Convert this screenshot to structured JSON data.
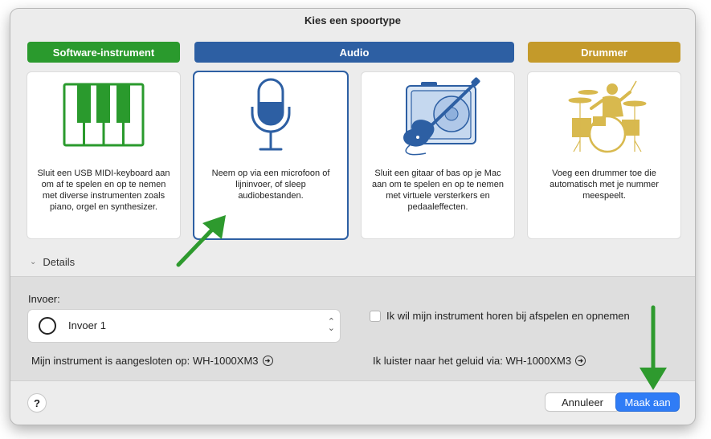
{
  "dialog": {
    "title": "Kies een spoortype"
  },
  "categories": [
    {
      "label": "Software-instrument",
      "color": "#2a9a2d",
      "description": "Sluit een USB MIDI-keyboard aan om af te spelen en op te nemen met diverse instrumenten zoals piano, orgel en synthesizer.",
      "icon": "piano-keyboard-icon"
    },
    {
      "label": "Audio",
      "color": "#2d5fa3",
      "description": "Neem op via een microfoon of lijninvoer, of sleep audiobestanden.",
      "icon": "microphone-icon"
    },
    {
      "label": "",
      "description": "Sluit een gitaar of bas op je Mac aan om te spelen en op te nemen met virtuele versterkers en pedaaleffecten.",
      "icon": "guitar-amp-icon"
    },
    {
      "label": "Drummer",
      "color": "#c49a2a",
      "description": "Voeg een drummer toe die automatisch met je nummer meespeelt.",
      "icon": "drummer-icon"
    }
  ],
  "details": {
    "label": "Details"
  },
  "input": {
    "label": "Invoer:",
    "selected": "Invoer 1",
    "checkbox_label": "Ik wil mijn instrument horen bij afspelen en opnemen",
    "checked": false,
    "connected_text": "Mijn instrument is aangesloten op: WH-1000XM3",
    "listen_text": "Ik luister naar het geluid via: WH-1000XM3"
  },
  "footer": {
    "help_label": "?",
    "cancel_label": "Annuleer",
    "create_label": "Maak aan"
  },
  "colors": {
    "accent": "#2f7cf6",
    "annotation_arrow": "#2e9a2e"
  }
}
